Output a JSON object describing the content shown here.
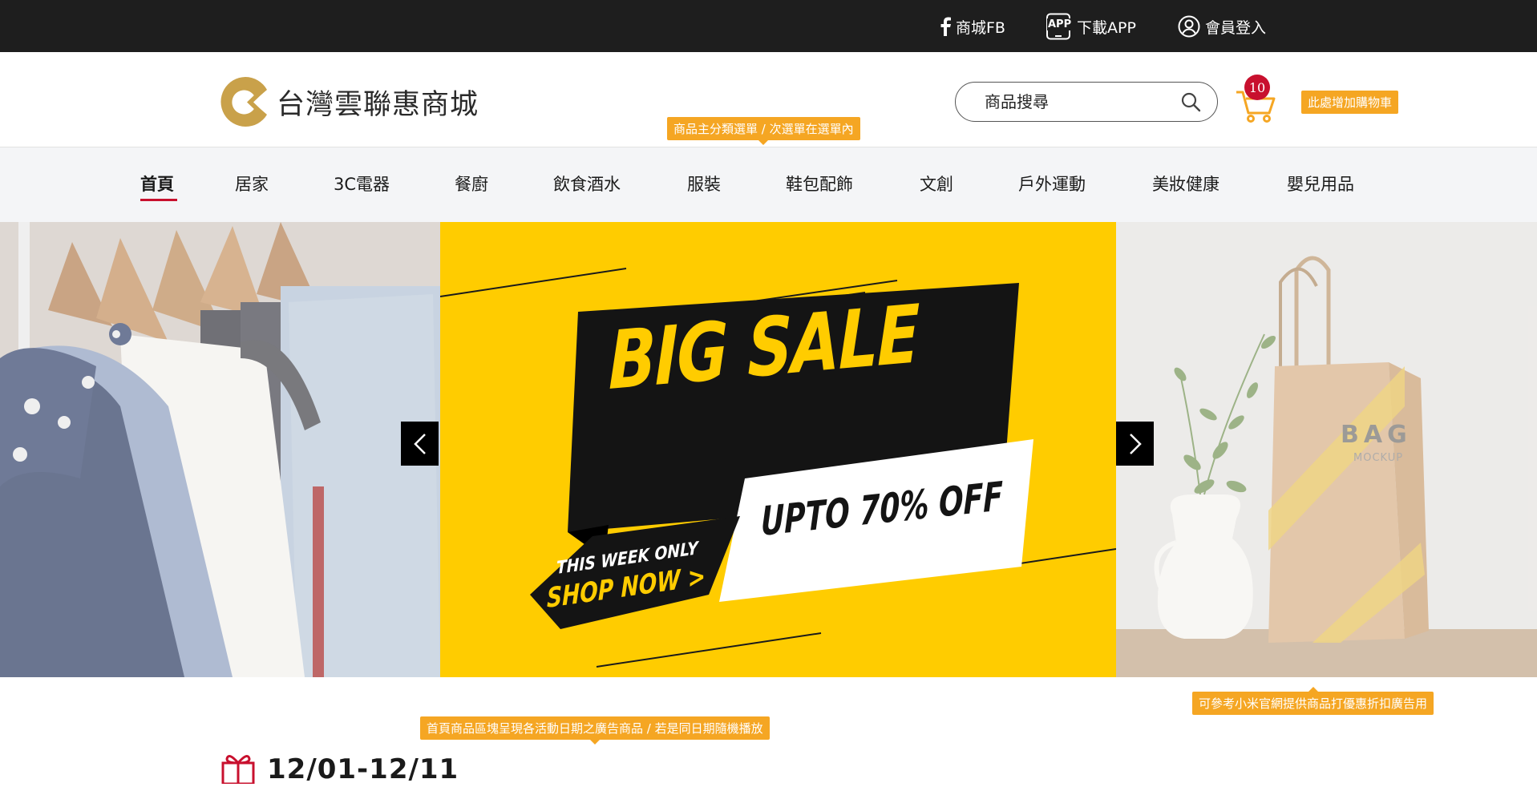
{
  "topbar": {
    "fb_label": "商城FB",
    "app_badge": "APP",
    "app_label": "下載APP",
    "login_label": "會員登入"
  },
  "header": {
    "logo_text": "台灣雲聯惠商城",
    "search_placeholder": "商品搜尋",
    "cart_count": "10",
    "cart_note": "此處增加購物車",
    "category_note": "商品主分類選單 / 次選單在選單內"
  },
  "nav": {
    "items": [
      "首頁",
      "居家",
      "3C電器",
      "餐廚",
      "飲食酒水",
      "服裝",
      "鞋包配飾",
      "文創",
      "戶外運動",
      "美妝健康",
      "嬰兒用品"
    ],
    "active_index": 0
  },
  "banner": {
    "headline": "BIG SALE",
    "offer": "UPTO 70% OFF",
    "tag_top": "THIS WEEK ONLY",
    "tag_bottom": "SHOP NOW >",
    "bag_title": "BAG",
    "bag_sub": "MOCKUP",
    "right_note": "可參考小米官網提供商品打優惠折扣廣告用"
  },
  "section": {
    "note": "首頁商品區塊呈現各活動日期之廣告商品 / 若是同日期隨機播放",
    "date_range": "12/01-12/11"
  },
  "colors": {
    "accent_red": "#c8102e",
    "note_orange": "#f5a623",
    "banner_yellow": "#ffcc00",
    "logo_gold": "#c9a14a"
  },
  "icons": [
    "facebook-icon",
    "app-icon",
    "user-icon",
    "search-icon",
    "cart-icon",
    "chevron-left-icon",
    "chevron-right-icon",
    "gift-icon"
  ]
}
